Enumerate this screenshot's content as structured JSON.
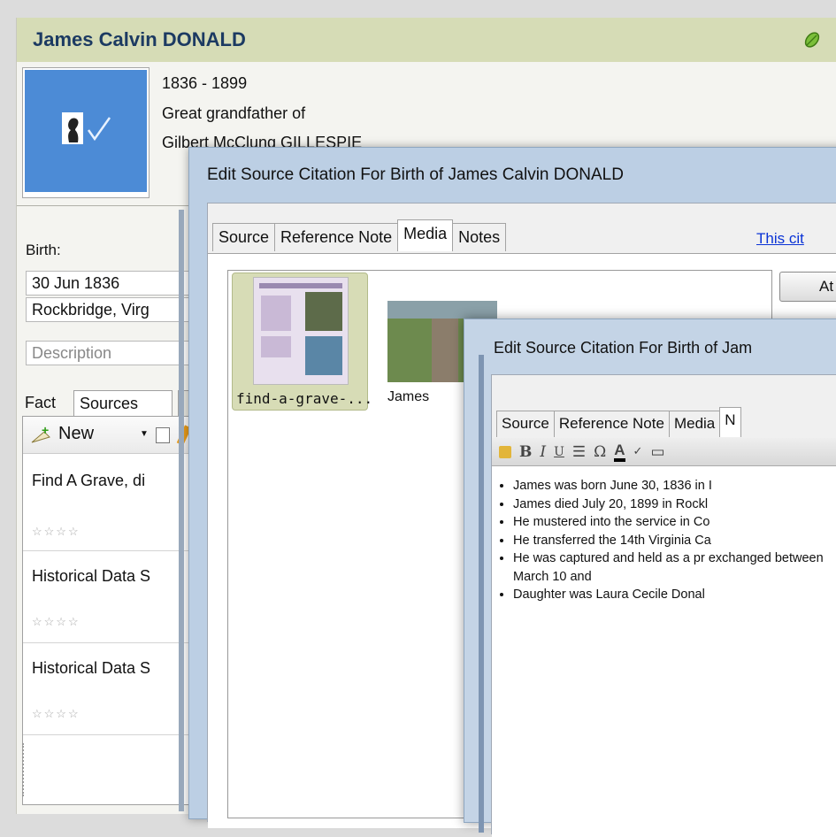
{
  "person": {
    "name": "James Calvin DONALD",
    "dates": "1836 - 1899",
    "relationship": "Great grandfather of",
    "related_person": "Gilbert McClung GILLESPIE",
    "birth_label": "Birth:",
    "birth_date": "30 Jun 1836",
    "birth_place": "Rockbridge, Virg",
    "description_placeholder": "Description",
    "tabs": [
      "Fact",
      "Sources"
    ],
    "toolbar_new": "New",
    "sources": [
      {
        "title": "Find A Grave, di",
        "stars": "☆☆☆☆"
      },
      {
        "title": "Historical Data S",
        "stars": "☆☆☆☆"
      },
      {
        "title": "Historical Data S",
        "stars": "☆☆☆☆"
      }
    ]
  },
  "dialog1": {
    "title": "Edit Source Citation For Birth of James Calvin DONALD",
    "tabs": [
      "Source",
      "Reference Note",
      "Media",
      "Notes"
    ],
    "active_tab": "Media",
    "link_text": "This cit",
    "attach_label": "At",
    "media": [
      {
        "caption": "find-a-grave-..."
      },
      {
        "caption": "James"
      }
    ]
  },
  "dialog2": {
    "title": "Edit Source Citation For Birth of Jam",
    "tabs": [
      "Source",
      "Reference Note",
      "Media",
      "N"
    ],
    "toolbar": [
      "B",
      "I",
      "U",
      "Ω",
      "A"
    ],
    "notes": [
      "James was born June 30, 1836 in I",
      "James died July 20, 1899 in Rockl",
      "He mustered into the service in Co",
      "He transferred the 14th Virginia Ca",
      "He was captured and held as a pr exchanged between March 10 and",
      "Daughter was Laura Cecile Donal"
    ]
  },
  "colors": {
    "header_bg": "#d6dcb6",
    "name_color": "#1c3a62",
    "photo_bg": "#4c8bd6",
    "link_color": "#0a33d6",
    "dialog_frame": "#bccfe4"
  }
}
